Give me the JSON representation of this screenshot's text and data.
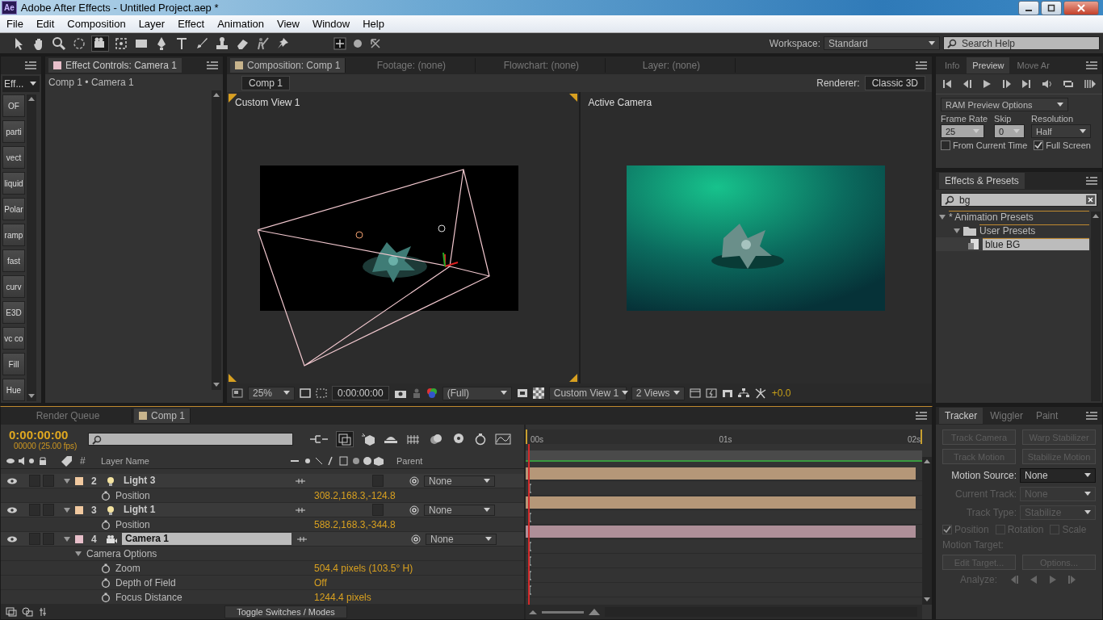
{
  "window": {
    "app_badge": "Ae",
    "title": "Adobe After Effects - Untitled Project.aep *"
  },
  "menu": [
    "File",
    "Edit",
    "Composition",
    "Layer",
    "Effect",
    "Animation",
    "View",
    "Window",
    "Help"
  ],
  "toolbar": {
    "workspace_label": "Workspace:",
    "workspace": "Standard",
    "search_placeholder": "Search Help"
  },
  "left_strip": {
    "dropdown": "Eff...",
    "buttons": [
      "OF",
      "parti",
      "vect",
      "liquid",
      "Polar",
      "ramp",
      "fast",
      "curv",
      "E3D",
      "vc co",
      "Fill",
      "Hue"
    ]
  },
  "effect_controls": {
    "tab": "Effect Controls: Camera 1",
    "breadcrumb": "Comp 1 • Camera 1"
  },
  "composition": {
    "tabs": [
      {
        "label": "Composition: Comp 1",
        "selected": true
      },
      {
        "label": "Footage: (none)",
        "selected": false
      },
      {
        "label": "Flowchart: (none)",
        "selected": false
      },
      {
        "label": "Layer: (none)",
        "selected": false
      }
    ],
    "comp_button": "Comp 1",
    "renderer_label": "Renderer:",
    "renderer": "Classic 3D",
    "views": [
      {
        "label": "Custom View 1",
        "kind": "wireframe"
      },
      {
        "label": "Active Camera",
        "kind": "camera"
      }
    ],
    "footer": {
      "zoom": "25%",
      "time": "0:00:00:00",
      "resolution": "(Full)",
      "view": "Custom View 1",
      "layout": "2 Views",
      "exposure": "+0.0"
    }
  },
  "preview": {
    "tabs": [
      {
        "label": "Info",
        "selected": false
      },
      {
        "label": "Preview",
        "selected": true
      },
      {
        "label": "Move Ar",
        "selected": false
      }
    ],
    "options": "RAM Preview Options",
    "frame_rate_label": "Frame Rate",
    "skip_label": "Skip",
    "resolution_label": "Resolution",
    "frame_rate": "25",
    "skip": "0",
    "resolution": "Half",
    "checkboxes": [
      {
        "label": "From Current Time",
        "checked": false
      },
      {
        "label": "Full Screen",
        "checked": true
      }
    ]
  },
  "effects_presets": {
    "tab": "Effects & Presets",
    "search": "bg",
    "tree": [
      {
        "label": "* Animation Presets",
        "expanded": true,
        "selected": false,
        "children": [
          {
            "label": "User Presets",
            "kind": "folder",
            "expanded": true,
            "selected": false,
            "children": [
              {
                "label": "blue BG",
                "kind": "preset",
                "selected": true
              }
            ]
          }
        ]
      }
    ]
  },
  "timeline": {
    "tabs": [
      {
        "label": "Render Queue",
        "selected": false
      },
      {
        "label": "Comp 1",
        "selected": true
      }
    ],
    "timecode": "0:00:00:00",
    "fps": "00000 (25.00 fps)",
    "col_number": "#",
    "col_name": "Layer Name",
    "col_parent": "Parent",
    "ruler": [
      "00s",
      "01s",
      "02s"
    ],
    "rows": [
      {
        "kind": "light",
        "number": "2",
        "name": "Light 3",
        "color": "#f1c9a0",
        "expanded": true,
        "selected": false,
        "solo": false,
        "locked": false,
        "three_d": false,
        "parent": "None"
      },
      {
        "kind": "property",
        "name": "Position",
        "value": "308.2,168.3,-124.8"
      },
      {
        "kind": "light",
        "number": "3",
        "name": "Light 1",
        "color": "#f1c9a0",
        "expanded": true,
        "selected": false,
        "solo": false,
        "locked": false,
        "three_d": false,
        "parent": "None"
      },
      {
        "kind": "property",
        "name": "Position",
        "value": "588.2,168.3,-344.8"
      },
      {
        "kind": "camera",
        "number": "4",
        "name": "Camera 1",
        "color": "#e8bfca",
        "expanded": true,
        "selected": true,
        "solo": false,
        "locked": false,
        "parent": "None"
      },
      {
        "kind": "group",
        "name": "Camera Options",
        "expanded": true
      },
      {
        "kind": "property",
        "name": "Zoom",
        "value": "504.4 pixels (103.5° H)"
      },
      {
        "kind": "property",
        "name": "Depth of Field",
        "value": "Off"
      },
      {
        "kind": "property",
        "name": "Focus Distance",
        "value": "1244.4 pixels"
      }
    ],
    "toggle": "Toggle Switches / Modes"
  },
  "tracker": {
    "tabs": [
      {
        "label": "Tracker",
        "selected": true
      },
      {
        "label": "Wiggler",
        "selected": false
      },
      {
        "label": "Paint",
        "selected": false
      }
    ],
    "buttons": [
      {
        "label": "Track Camera",
        "disabled": true
      },
      {
        "label": "Warp Stabilizer",
        "disabled": true
      },
      {
        "label": "Track Motion",
        "disabled": true
      },
      {
        "label": "Stabilize Motion",
        "disabled": true
      }
    ],
    "fields": [
      {
        "label": "Motion Source:",
        "value": "None",
        "disabled": false
      },
      {
        "label": "Current Track:",
        "value": "None",
        "disabled": true
      },
      {
        "label": "Track Type:",
        "value": "Stabilize",
        "disabled": true
      }
    ],
    "checkboxes": [
      {
        "label": "Position",
        "checked": true
      },
      {
        "label": "Rotation",
        "checked": false
      },
      {
        "label": "Scale",
        "checked": false
      }
    ],
    "motion_target": "Motion Target:",
    "target_buttons": [
      {
        "label": "Edit Target...",
        "disabled": true
      },
      {
        "label": "Options...",
        "disabled": true
      }
    ],
    "analyze": "Analyze:"
  }
}
